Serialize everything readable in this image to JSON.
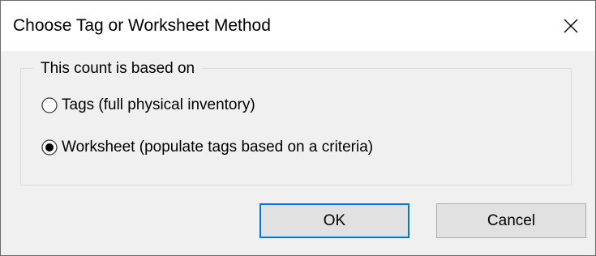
{
  "window": {
    "title": "Choose Tag or Worksheet Method",
    "close_icon": "close-icon"
  },
  "group": {
    "legend": "This count is based on",
    "options": [
      {
        "label": "Tags (full physical inventory)",
        "selected": false
      },
      {
        "label": "Worksheet (populate tags based on a criteria)",
        "selected": true
      }
    ]
  },
  "buttons": {
    "ok_label": "OK",
    "cancel_label": "Cancel"
  },
  "colors": {
    "accent": "#0078d7",
    "dialog_background": "#f0f0f0",
    "title_background": "#ffffff"
  }
}
